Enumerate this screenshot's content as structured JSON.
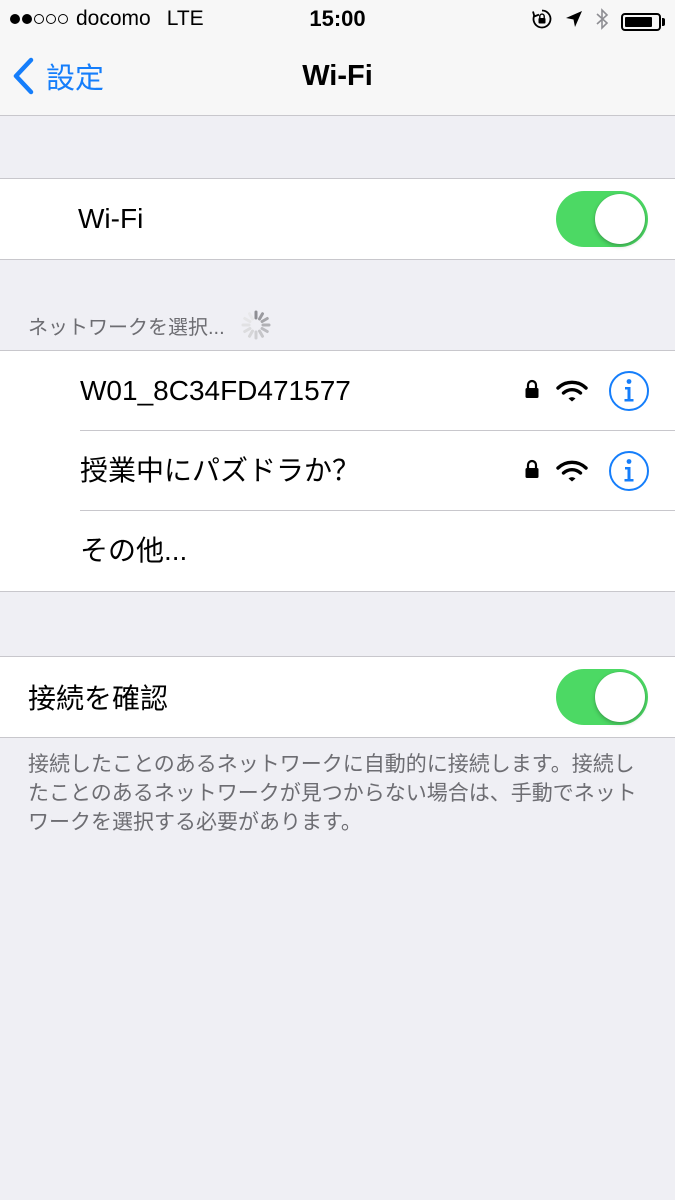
{
  "status_bar": {
    "signal_filled": 2,
    "signal_total": 5,
    "carrier": "docomo",
    "network": "LTE",
    "time": "15:00",
    "icons": [
      "rotation-lock-icon",
      "location-arrow-icon",
      "bluetooth-icon",
      "battery-icon"
    ],
    "battery_level": 0.85
  },
  "nav": {
    "back_label": "設定",
    "title": "Wi-Fi"
  },
  "wifi_toggle": {
    "label": "Wi-Fi",
    "on": true
  },
  "networks": {
    "header": "ネットワークを選択...",
    "items": [
      {
        "name": "W01_8C34FD471577",
        "secured": true,
        "icons": [
          "lock-icon",
          "wifi-signal-icon",
          "info-icon"
        ]
      },
      {
        "name": "授業中にパズドラか？",
        "secured": true,
        "icons": [
          "lock-icon",
          "wifi-signal-icon",
          "info-icon"
        ]
      }
    ],
    "other_label": "その他..."
  },
  "ask_to_join": {
    "label": "接続を確認",
    "on": true,
    "footer": "接続したことのあるネットワークに自動的に接続します。接続したことのあるネットワークが見つからない場合は、手動でネットワークを選択する必要があります。"
  },
  "colors": {
    "accent": "#157efb",
    "toggle_on": "#4cd964",
    "background": "#efeff4",
    "secondary_text": "#6d6d72"
  }
}
